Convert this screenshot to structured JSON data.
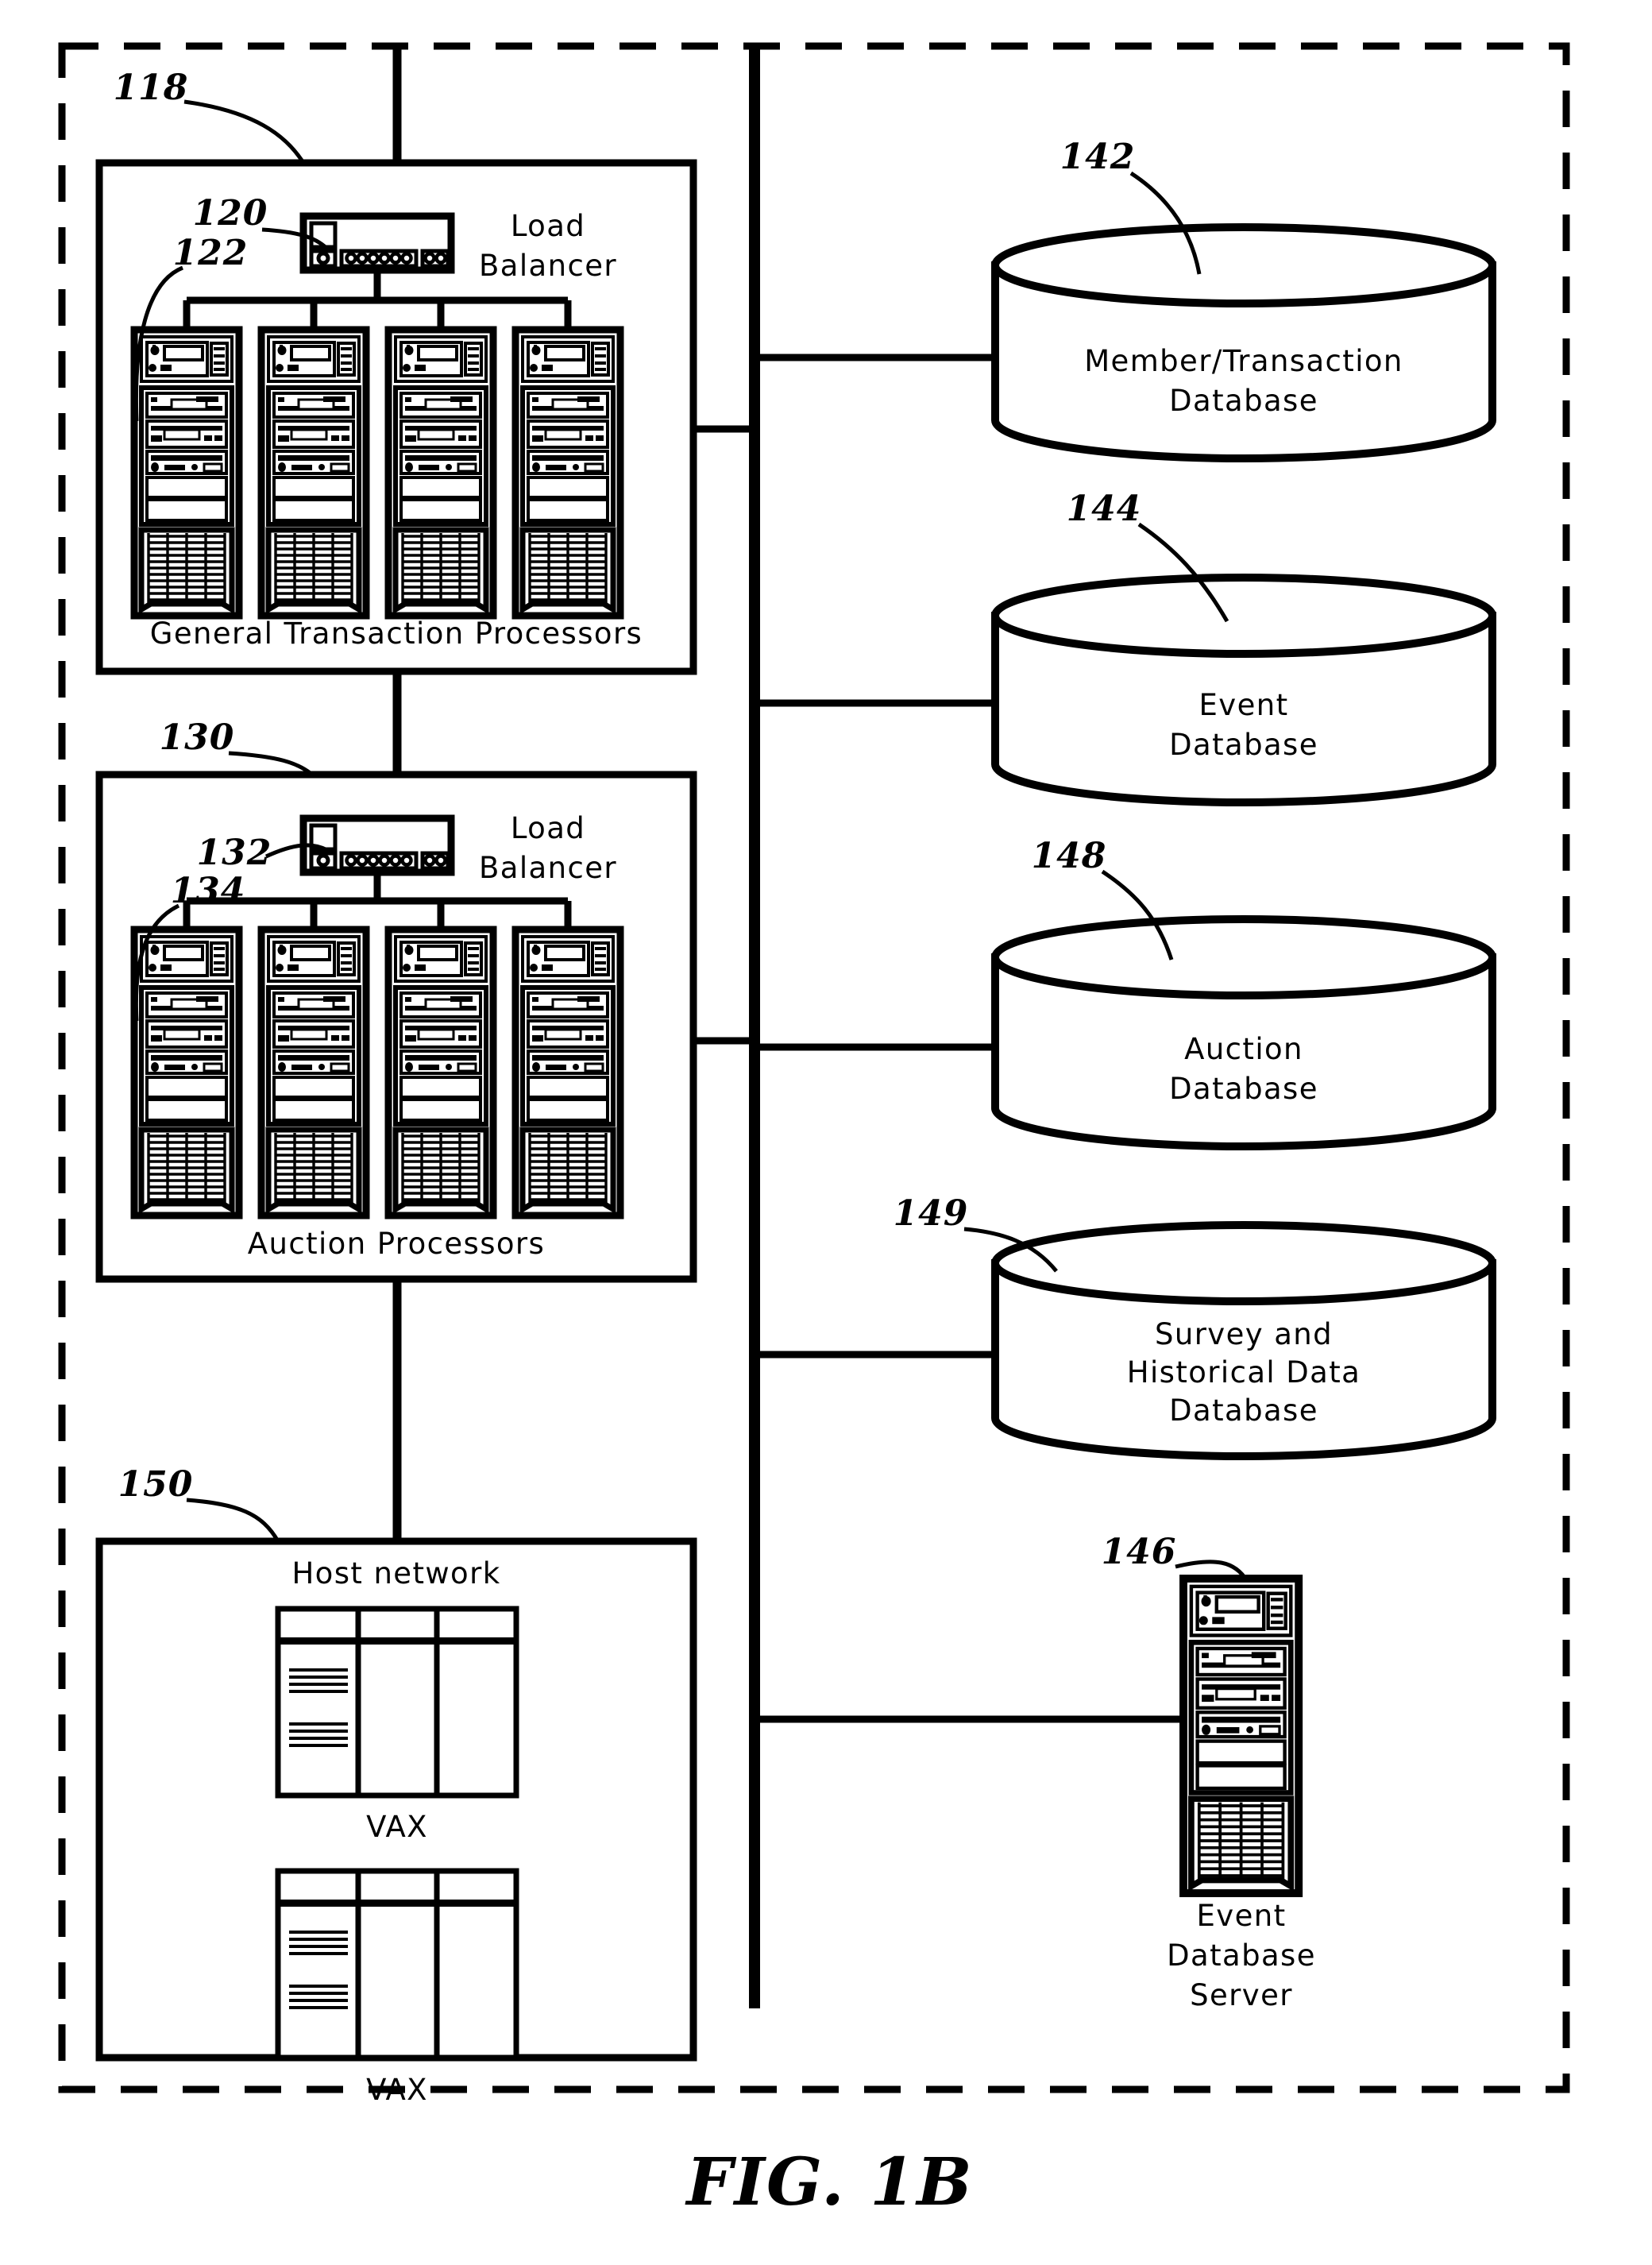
{
  "figure": {
    "caption": "FIG.  1B",
    "type": "patent-system-architecture-diagram"
  },
  "outer_boundary": {
    "style": "dashed",
    "reference": null
  },
  "groups": [
    {
      "id": "general-transaction-processors",
      "ref": "118",
      "label": "General  Transaction  Processors",
      "load_balancer": {
        "ref": "120",
        "label_line1": "Load",
        "label_line2": "Balancer",
        "ports_left": 1,
        "ports_middle": 6,
        "ports_right": 2
      },
      "servers": {
        "ref": "122",
        "count": 4
      }
    },
    {
      "id": "auction-processors",
      "ref": "130",
      "label": "Auction  Processors",
      "load_balancer": {
        "ref": "132",
        "label_line1": "Load",
        "label_line2": "Balancer",
        "ports_left": 1,
        "ports_middle": 6,
        "ports_right": 2
      },
      "servers": {
        "ref": "134",
        "count": 4
      }
    },
    {
      "id": "host-network",
      "ref": "150",
      "label": "Host  network",
      "machines": [
        {
          "label": "VAX"
        },
        {
          "label": "VAX"
        }
      ]
    }
  ],
  "databases": [
    {
      "ref": "142",
      "lines": [
        "Member/Transaction",
        "Database"
      ]
    },
    {
      "ref": "144",
      "lines": [
        "Event",
        "Database"
      ]
    },
    {
      "ref": "148",
      "lines": [
        "Auction",
        "Database"
      ]
    },
    {
      "ref": "149",
      "lines": [
        "Survey  and",
        "Historical  Data",
        "Database"
      ]
    }
  ],
  "servers_standalone": [
    {
      "ref": "146",
      "lines": [
        "Event",
        "Database",
        "Server"
      ]
    }
  ],
  "colors": {
    "ink": "#000000",
    "paper": "#ffffff"
  }
}
